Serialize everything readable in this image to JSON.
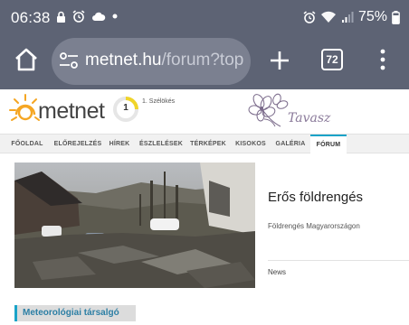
{
  "status_bar": {
    "time": "06:38",
    "battery_percent": "75%",
    "left_icons": [
      "lock-icon",
      "alarm-icon",
      "cloud-icon",
      "dot-icon"
    ],
    "right_icons": [
      "alarm-icon",
      "wifi-icon",
      "signal-icon",
      "battery-icon"
    ]
  },
  "browser": {
    "url_host": "metnet.hu",
    "url_path": "/forum?top",
    "tab_count": "72",
    "colors": {
      "toolbar": "#5d6374",
      "url_box": "#7b8090"
    }
  },
  "site": {
    "logo_text": "metnet",
    "gauge_value": "1",
    "gauge_label": "1. Szélökés",
    "season_label": "Tavasz",
    "accent_color": "#1aa3c8"
  },
  "nav": {
    "items": [
      {
        "label": "FŐOLDAL"
      },
      {
        "label": "ELŐREJELZÉS"
      },
      {
        "label": "HÍREK"
      },
      {
        "label": "ÉSZLELÉSEK"
      },
      {
        "label": "TÉRKÉPEK"
      },
      {
        "label": "KISOKOS"
      },
      {
        "label": "GALÉRIA"
      },
      {
        "label": "FÓRUM"
      }
    ],
    "active_index": 7
  },
  "article": {
    "title": "Erős földrengés",
    "subtitle": "Földrengés Magyarországon",
    "category": "News"
  },
  "section": {
    "label": "Meteorológiai társalgó"
  }
}
